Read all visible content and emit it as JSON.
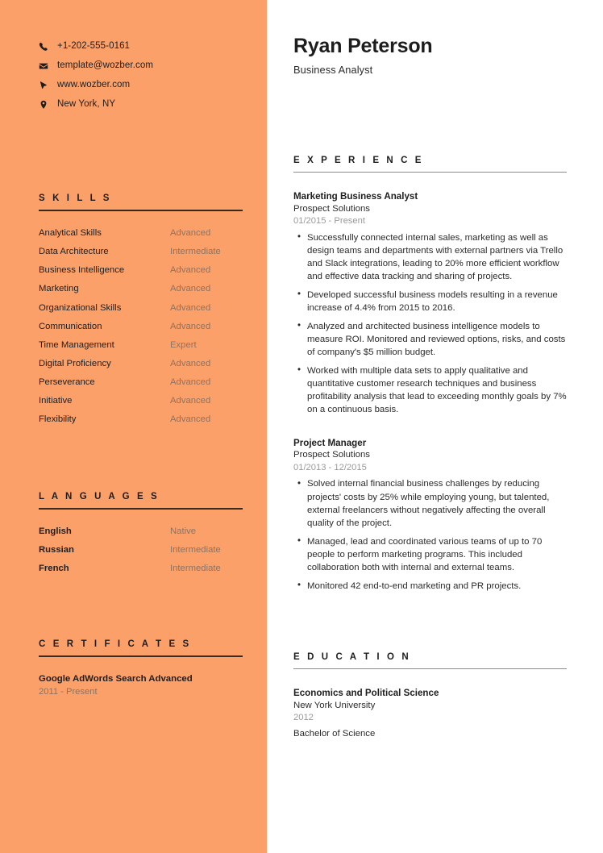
{
  "colors": {
    "sidebar_background": "#fca06a",
    "sidebar_rule": "#3a2a1d",
    "main_rule": "#8c8c8c",
    "muted_sidebar_text": "#8a7363",
    "muted_main_text": "#9a9a9a",
    "primary_text": "#1d1d1d"
  },
  "header": {
    "name": "Ryan Peterson",
    "title": "Business Analyst"
  },
  "contact": [
    {
      "icon": "phone-icon",
      "text": "+1-202-555-0161"
    },
    {
      "icon": "envelope-icon",
      "text": "template@wozber.com"
    },
    {
      "icon": "cursor-icon",
      "text": "www.wozber.com"
    },
    {
      "icon": "location-pin-icon",
      "text": "New York, NY"
    }
  ],
  "skills": {
    "heading": "S K I L L S",
    "items": [
      {
        "name": "Analytical Skills",
        "level": "Advanced"
      },
      {
        "name": "Data Architecture",
        "level": "Intermediate"
      },
      {
        "name": "Business Intelligence",
        "level": "Advanced"
      },
      {
        "name": "Marketing",
        "level": "Advanced"
      },
      {
        "name": "Organizational Skills",
        "level": "Advanced"
      },
      {
        "name": "Communication",
        "level": "Advanced"
      },
      {
        "name": "Time Management",
        "level": "Expert"
      },
      {
        "name": "Digital Proficiency",
        "level": "Advanced"
      },
      {
        "name": "Perseverance",
        "level": "Advanced"
      },
      {
        "name": "Initiative",
        "level": "Advanced"
      },
      {
        "name": "Flexibility",
        "level": "Advanced"
      }
    ]
  },
  "languages": {
    "heading": "L A N G U A G E S",
    "items": [
      {
        "name": "English",
        "level": "Native"
      },
      {
        "name": "Russian",
        "level": "Intermediate"
      },
      {
        "name": "French",
        "level": "Intermediate"
      }
    ]
  },
  "certificates": {
    "heading": "C E R T I F I C A T E S",
    "items": [
      {
        "title": "Google AdWords Search Advanced",
        "date": "2011 - Present"
      }
    ]
  },
  "experience": {
    "heading": "E X P E R I E N C E",
    "entries": [
      {
        "title": "Marketing Business Analyst",
        "org": "Prospect Solutions",
        "date": "01/2015 - Present",
        "bullets": [
          "Successfully connected internal sales, marketing as well as design teams and departments with external partners via Trello and Slack integrations, leading to 20% more efficient workflow and effective data tracking and sharing of projects.",
          "Developed successful business models resulting in a revenue increase of 4.4% from 2015 to 2016.",
          "Analyzed and architected business intelligence models to measure ROI. Monitored and reviewed options, risks, and costs of company's $5 million budget.",
          "Worked with multiple data sets to apply qualitative and quantitative customer research techniques and business profitability analysis that lead to exceeding monthly goals by 7% on a continuous basis."
        ]
      },
      {
        "title": "Project Manager",
        "org": "Prospect Solutions",
        "date": "01/2013 - 12/2015",
        "bullets": [
          "Solved internal financial business challenges by reducing projects' costs by 25% while employing young, but talented, external freelancers without negatively affecting the overall quality of the project.",
          "Managed, lead and coordinated various teams of up to 70 people to perform marketing programs. This included collaboration both with internal and external teams.",
          "Monitored 42 end-to-end marketing and PR projects."
        ]
      }
    ]
  },
  "education": {
    "heading": "E D U C A T I O N",
    "entries": [
      {
        "title": "Economics and Political Science",
        "org": "New York University",
        "date": "2012",
        "degree": "Bachelor of Science"
      }
    ]
  }
}
